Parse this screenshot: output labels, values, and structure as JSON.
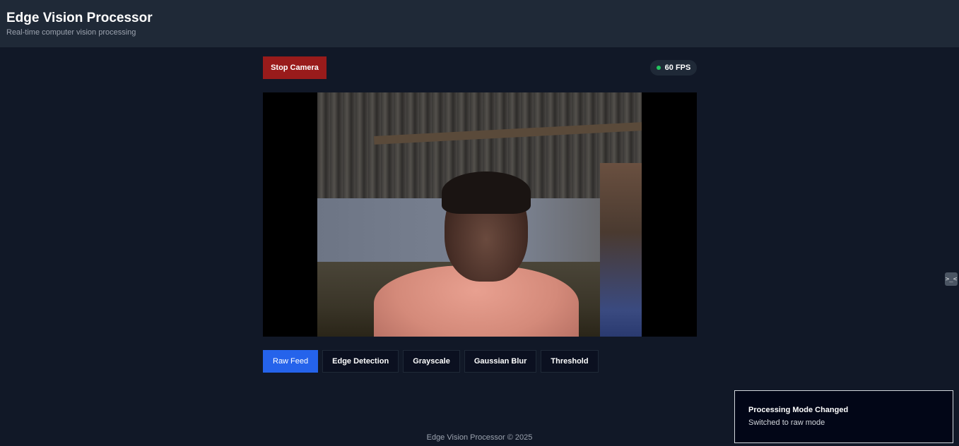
{
  "header": {
    "title": "Edge Vision Processor",
    "subtitle": "Real-time computer vision processing"
  },
  "controls": {
    "stop_label": "Stop Camera",
    "fps_label": "60 FPS",
    "fps_status_color": "#22c55e"
  },
  "modes": {
    "items": [
      {
        "label": "Raw Feed",
        "active": true
      },
      {
        "label": "Edge Detection",
        "active": false
      },
      {
        "label": "Grayscale",
        "active": false
      },
      {
        "label": "Gaussian Blur",
        "active": false
      },
      {
        "label": "Threshold",
        "active": false
      }
    ],
    "active_color": "#2563eb"
  },
  "footer": {
    "text": "Edge Vision Processor © 2025"
  },
  "toast": {
    "title": "Processing Mode Changed",
    "description": "Switched to raw mode"
  },
  "side_tab": {
    "icon": "dev-tools-icon",
    "glyph": ">_<"
  },
  "colors": {
    "background": "#111827",
    "header": "#1f2937",
    "stop_button": "#991b1b"
  }
}
